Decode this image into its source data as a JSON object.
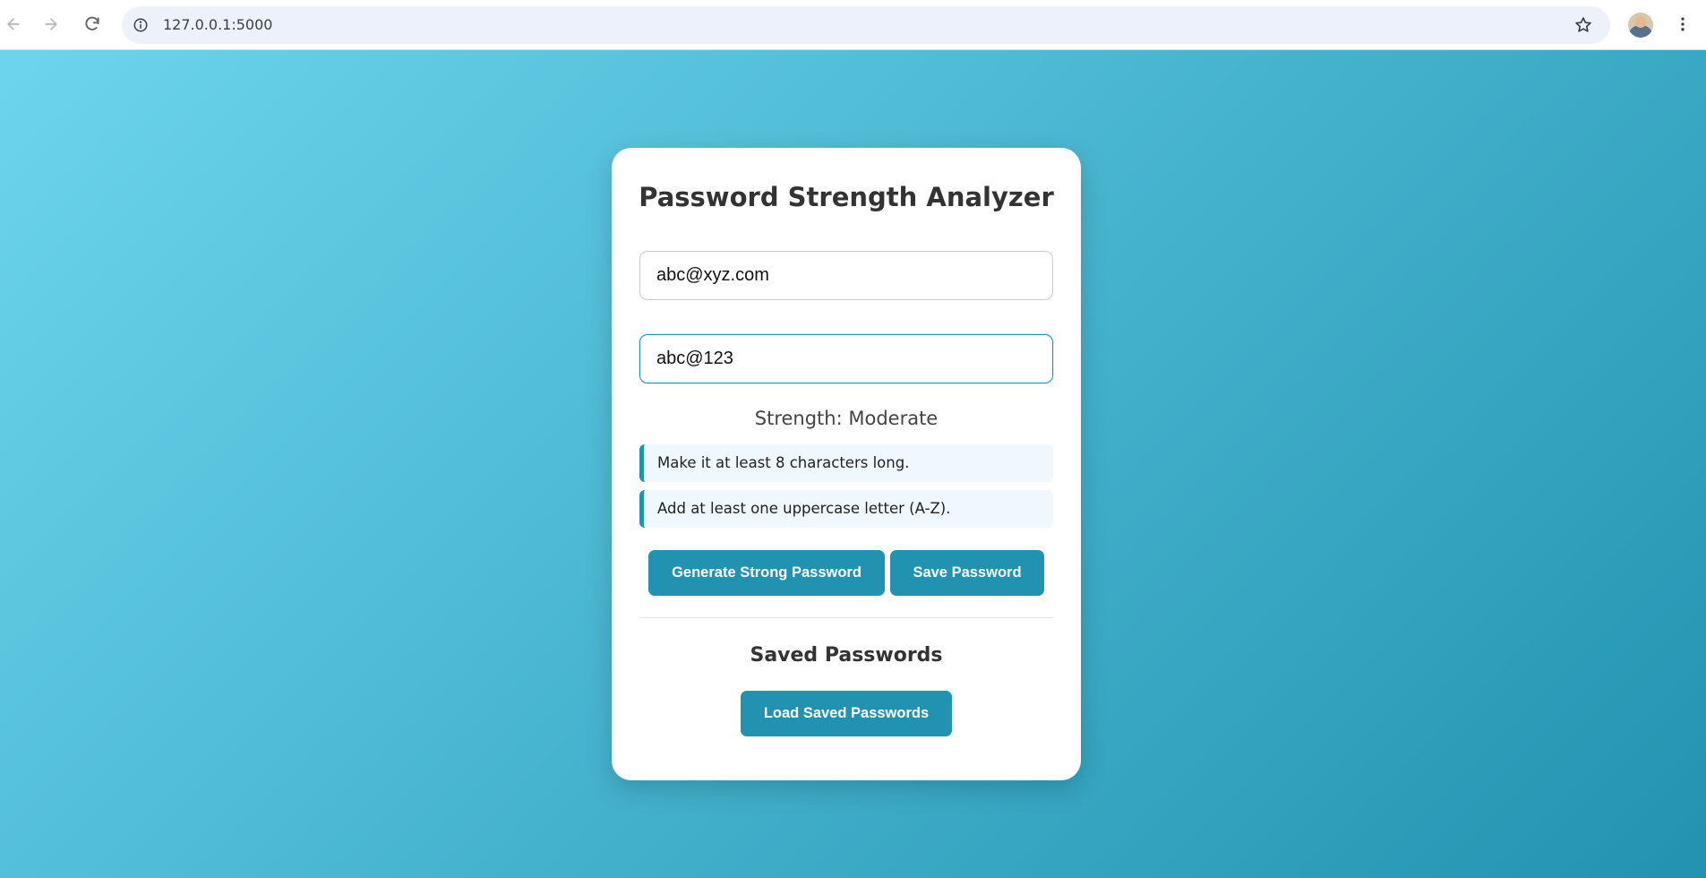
{
  "browser": {
    "url": "127.0.0.1:5000"
  },
  "card": {
    "title": "Password Strength Analyzer",
    "email_value": "abc@xyz.com",
    "password_value": "abc@123",
    "strength_text": "Strength: Moderate",
    "suggestions": [
      "Make it at least 8 characters long.",
      "Add at least one uppercase letter (A-Z)."
    ],
    "generate_label": "Generate Strong Password",
    "save_label": "Save Password",
    "saved_heading": "Saved Passwords",
    "load_label": "Load Saved Passwords"
  },
  "colors": {
    "gradient_start": "#6dd5ed",
    "gradient_end": "#2193b0",
    "accent": "#2193b0"
  },
  "icons": {
    "back": "arrow-left-icon",
    "forward": "arrow-right-icon",
    "reload": "reload-icon",
    "site_info": "info-icon",
    "bookmark": "star-icon",
    "menu": "kebab-menu-icon"
  }
}
